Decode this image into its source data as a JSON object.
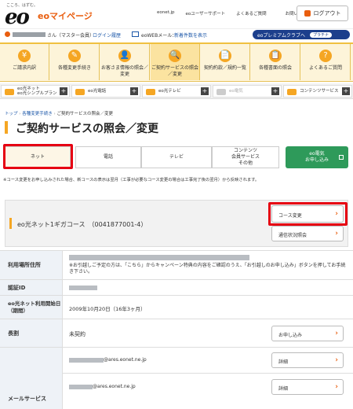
{
  "header": {
    "tagline": "こころ、はずむ。",
    "logo": "eo",
    "site_title": "eoマイページ",
    "links": [
      "eonet.jp",
      "eoユーザーサポート",
      "よくあるご質問",
      "お問い合わせ"
    ],
    "logout": "ログアウト",
    "user_suffix": "さん（マスター会員）",
    "login_history": "ログイン履歴",
    "webmail_label": "eoWEBメール：",
    "webmail_link": "新着件数を表示",
    "premium": "eoプレミアムクラブへ",
    "premium_badge": "プラチナ"
  },
  "nav": [
    {
      "label": "ご請求内訳",
      "icon": "¥"
    },
    {
      "label": "各種変更手続き",
      "icon": "✎"
    },
    {
      "label": "お客さま情報の照会／変更",
      "icon": "👤"
    },
    {
      "label": "ご契約サービスの照会／変更",
      "icon": "🔍"
    },
    {
      "label": "契約約款／規約一覧",
      "icon": "📄"
    },
    {
      "label": "各種書面の照会",
      "icon": "📋"
    },
    {
      "label": "よくあるご質問",
      "icon": "?"
    }
  ],
  "services": [
    {
      "label": "eo光ネット\neo光シンプルプラン",
      "plus": "+"
    },
    {
      "label": "eo光電話",
      "plus": "+"
    },
    {
      "label": "eo光テレビ",
      "plus": "+"
    },
    {
      "label": "eo電気",
      "plus": "+"
    },
    {
      "label": "コンテンツサービス",
      "plus": "+"
    }
  ],
  "breadcrumb": [
    "トップ",
    "各種変更手続き",
    "ご契約サービスの照会／変更"
  ],
  "page_title": "ご契約サービスの照会／変更",
  "tabs": [
    "ネット",
    "電話",
    "テレビ",
    "コンテンツ\n会員サービス\nその他"
  ],
  "apply_btn": "eo電気\nお申し込み",
  "notice": "※コース変更をお申し込みされた場合、新コースの表示は翌月（工事が必要なコース変更の場合は工事完了後の翌月）から反映されます。",
  "course": {
    "name": "eo光ネット1ギガコース　（0041877001-4）",
    "change_btn": "コース変更",
    "speed_btn": "通信状況照会"
  },
  "table": {
    "address_label": "利用場所住所",
    "address_note": "※お引越しご予定の方は、「こちら」からキャンペーン特典の内容をご確認のうえ、「お引越しのお申し込み」ボタンを押してお手続き下さい。",
    "auth_label": "認証ID",
    "start_label": "eo光ネット利用開始日（期間）",
    "start_value": "2009年10月20日（16年3ヶ月）",
    "long_label": "長割",
    "long_value": "未契約",
    "long_btn": "お申し込み",
    "mail_label": "メールサービス",
    "mail1": "@ares.eonet.ne.jp",
    "mail2": "@ares.eonet.ne.jp",
    "detail_btn": "詳細"
  }
}
